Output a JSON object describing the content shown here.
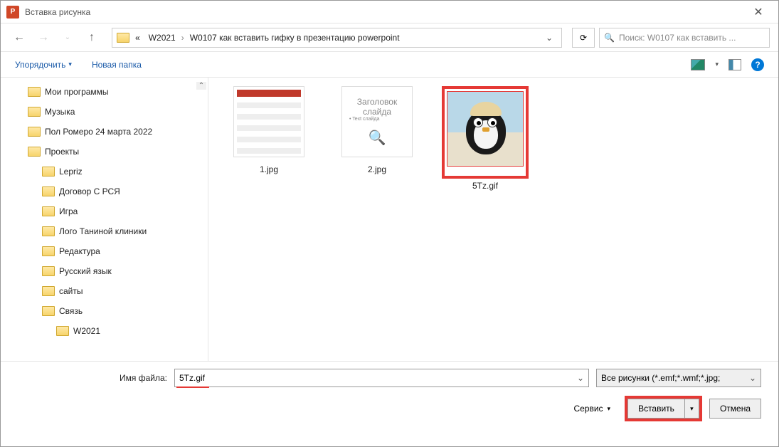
{
  "title": "Вставка рисунка",
  "app_icon": "P",
  "breadcrumb": {
    "prefix": "«",
    "p1": "W2021",
    "p2": "W0107 как вставить гифку в презентацию powerpoint"
  },
  "search_placeholder": "Поиск: W0107 как вставить ...",
  "toolbar": {
    "organize": "Упорядочить",
    "newfolder": "Новая папка",
    "help": "?"
  },
  "tree": [
    {
      "label": "Мои программы",
      "depth": 0
    },
    {
      "label": "Музыка",
      "depth": 0
    },
    {
      "label": "Пол Ромеро 24 марта 2022",
      "depth": 0
    },
    {
      "label": "Проекты",
      "depth": 0
    },
    {
      "label": "Lepriz",
      "depth": 1
    },
    {
      "label": "Договор С РСЯ",
      "depth": 1
    },
    {
      "label": "Игра",
      "depth": 1
    },
    {
      "label": "Лого Таниной клиники",
      "depth": 1
    },
    {
      "label": "Редактура",
      "depth": 1
    },
    {
      "label": "Русский язык",
      "depth": 1
    },
    {
      "label": "сайты",
      "depth": 1
    },
    {
      "label": "Связь",
      "depth": 1
    },
    {
      "label": "W2021",
      "depth": 2
    }
  ],
  "files": [
    {
      "name": "1.jpg"
    },
    {
      "name": "2.jpg"
    },
    {
      "name": "5Tz.gif",
      "selected": true
    }
  ],
  "thumb2": {
    "line1": "Заголовок слайда",
    "line2": "• Text слайда"
  },
  "footer": {
    "fname_label": "Имя файла:",
    "fname_value": "5Tz.gif",
    "filter": "Все рисунки (*.emf;*.wmf;*.jpg;",
    "tools": "Сервис",
    "insert": "Вставить",
    "cancel": "Отмена"
  }
}
